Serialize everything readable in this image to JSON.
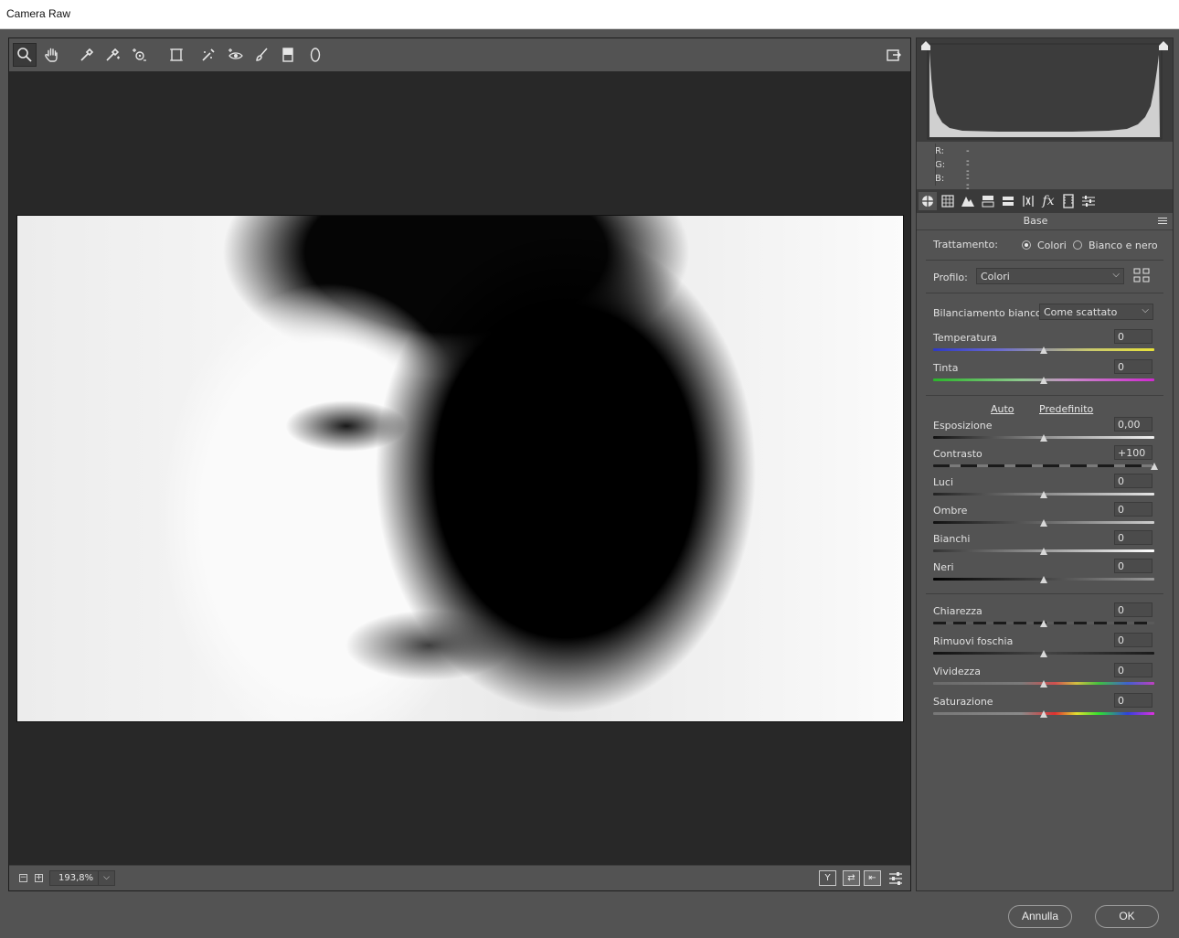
{
  "window": {
    "title": "Camera Raw"
  },
  "toolbar": {
    "tools": [
      "zoom-tool",
      "hand-tool",
      "white-balance-tool",
      "color-sampler-tool",
      "targeted-adjustment-tool",
      "transform-tool",
      "spot-removal-tool",
      "red-eye-removal-tool",
      "adjustment-brush",
      "graduated-filter",
      "radial-filter"
    ],
    "active_tool": "zoom-tool"
  },
  "zoom": {
    "minus": "−",
    "plus": "+",
    "value": "193,8%"
  },
  "histogram": {
    "r_label": "R:",
    "g_label": "G:",
    "b_label": "B:",
    "r_value": "---",
    "g_value": "---",
    "b_value": "---"
  },
  "panel": {
    "tabs": [
      "basic-icon",
      "tone-curve-icon",
      "detail-icon",
      "hsl-icon",
      "split-toning-icon",
      "lens-icon",
      "effects-icon",
      "calibration-icon",
      "presets-icon"
    ],
    "section_title": "Base",
    "treatment": {
      "label": "Trattamento:",
      "option_color": "Colori",
      "option_bw": "Bianco e nero",
      "selected": "Colori"
    },
    "profile": {
      "label": "Profilo:",
      "value": "Colori"
    },
    "white_balance": {
      "label": "Bilanciamento bianco:",
      "value": "Come scattato"
    },
    "auto_link": "Auto",
    "default_link": "Predefinito",
    "sliders": {
      "temperature": {
        "label": "Temperatura",
        "value": "0",
        "position": 0.5
      },
      "tint": {
        "label": "Tinta",
        "value": "0",
        "position": 0.5
      },
      "exposure": {
        "label": "Esposizione",
        "value": "0,00",
        "position": 0.5
      },
      "contrast": {
        "label": "Contrasto",
        "value": "+100",
        "position": 1.0
      },
      "highlights": {
        "label": "Luci",
        "value": "0",
        "position": 0.5
      },
      "shadows": {
        "label": "Ombre",
        "value": "0",
        "position": 0.5
      },
      "whites": {
        "label": "Bianchi",
        "value": "0",
        "position": 0.5
      },
      "blacks": {
        "label": "Neri",
        "value": "0",
        "position": 0.5
      },
      "clarity": {
        "label": "Chiarezza",
        "value": "0",
        "position": 0.5
      },
      "dehaze": {
        "label": "Rimuovi foschia",
        "value": "0",
        "position": 0.5
      },
      "vibrance": {
        "label": "Vividezza",
        "value": "0",
        "position": 0.5
      },
      "saturation": {
        "label": "Saturazione",
        "value": "0",
        "position": 0.5
      }
    }
  },
  "footer": {
    "cancel_label": "Annulla",
    "ok_label": "OK"
  },
  "colors": {
    "window_bg": "#535353",
    "canvas_bg": "#282828",
    "panel_bg": "#535353"
  }
}
